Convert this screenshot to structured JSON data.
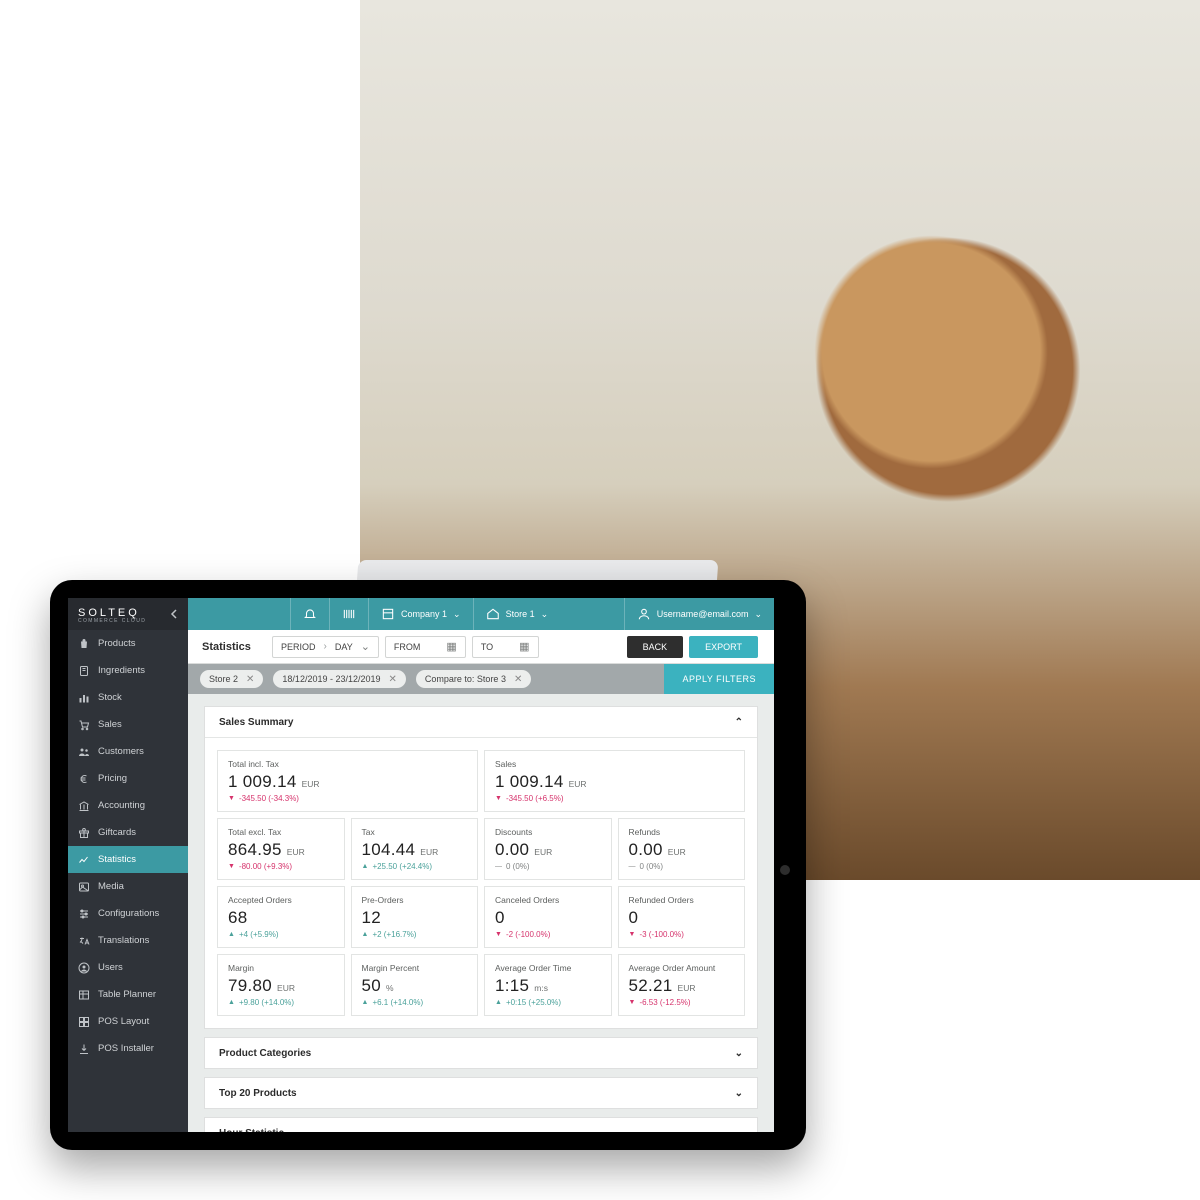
{
  "brand": {
    "main": "SOLTEQ",
    "sub": "COMMERCE CLOUD"
  },
  "sidebar": {
    "items": [
      {
        "icon": "bag",
        "label": "Products"
      },
      {
        "icon": "leaf",
        "label": "Ingredients"
      },
      {
        "icon": "bars",
        "label": "Stock"
      },
      {
        "icon": "cart",
        "label": "Sales"
      },
      {
        "icon": "people",
        "label": "Customers"
      },
      {
        "icon": "euro",
        "label": "Pricing"
      },
      {
        "icon": "bank",
        "label": "Accounting"
      },
      {
        "icon": "gift",
        "label": "Giftcards"
      },
      {
        "icon": "chart",
        "label": "Statistics"
      },
      {
        "icon": "image",
        "label": "Media"
      },
      {
        "icon": "sliders",
        "label": "Configurations"
      },
      {
        "icon": "lang",
        "label": "Translations"
      },
      {
        "icon": "user",
        "label": "Users"
      },
      {
        "icon": "table",
        "label": "Table Planner"
      },
      {
        "icon": "layout",
        "label": "POS Layout"
      },
      {
        "icon": "install",
        "label": "POS Installer"
      }
    ],
    "active_index": 8
  },
  "topbar": {
    "company": "Company 1",
    "store": "Store 1",
    "user": "Username@email.com"
  },
  "filters": {
    "title": "Statistics",
    "period_label": "PERIOD",
    "day_label": "DAY",
    "from_label": "FROM",
    "to_label": "TO",
    "back": "BACK",
    "export": "EXPORT"
  },
  "pills": {
    "store": "Store 2",
    "range": "18/12/2019 - 23/12/2019",
    "compare": "Compare to: Store 3",
    "apply": "APPLY FILTERS"
  },
  "summary": {
    "title": "Sales Summary",
    "cards": [
      {
        "span": 2,
        "label": "Total incl. Tax",
        "value": "1 009.14",
        "unit": "EUR",
        "delta_dir": "down",
        "delta": "-345.50 (-34.3%)"
      },
      {
        "span": 2,
        "label": "Sales",
        "value": "1 009.14",
        "unit": "EUR",
        "delta_dir": "down",
        "delta": "-345.50 (+6.5%)"
      },
      {
        "label": "Total excl. Tax",
        "value": "864.95",
        "unit": "EUR",
        "delta_dir": "down",
        "delta": "-80.00 (+9.3%)"
      },
      {
        "label": "Tax",
        "value": "104.44",
        "unit": "EUR",
        "delta_dir": "up",
        "delta": "+25.50 (+24.4%)"
      },
      {
        "label": "Discounts",
        "value": "0.00",
        "unit": "EUR",
        "delta_dir": "neutral",
        "delta": "0 (0%)"
      },
      {
        "label": "Refunds",
        "value": "0.00",
        "unit": "EUR",
        "delta_dir": "neutral",
        "delta": "0 (0%)"
      },
      {
        "label": "Accepted Orders",
        "value": "68",
        "unit": "",
        "delta_dir": "up",
        "delta": "+4 (+5.9%)"
      },
      {
        "label": "Pre-Orders",
        "value": "12",
        "unit": "",
        "delta_dir": "up",
        "delta": "+2 (+16.7%)"
      },
      {
        "label": "Canceled Orders",
        "value": "0",
        "unit": "",
        "delta_dir": "down",
        "delta": "-2 (-100.0%)"
      },
      {
        "label": "Refunded Orders",
        "value": "0",
        "unit": "",
        "delta_dir": "down",
        "delta": "-3 (-100.0%)"
      },
      {
        "label": "Margin",
        "value": "79.80",
        "unit": "EUR",
        "delta_dir": "up",
        "delta": "+9.80 (+14.0%)"
      },
      {
        "label": "Margin Percent",
        "value": "50",
        "unit": "%",
        "delta_dir": "up",
        "delta": "+6.1 (+14.0%)"
      },
      {
        "label": "Average  Order Time",
        "value": "1:15",
        "unit": "m:s",
        "delta_dir": "up",
        "delta": "+0:15 (+25.0%)"
      },
      {
        "label": "Average Order Amount",
        "value": "52.21",
        "unit": "EUR",
        "delta_dir": "down",
        "delta": "-6.53 (-12.5%)"
      }
    ]
  },
  "collapsed_panels": [
    "Product Categories",
    "Top 20 Products",
    "Hour Statistic"
  ]
}
